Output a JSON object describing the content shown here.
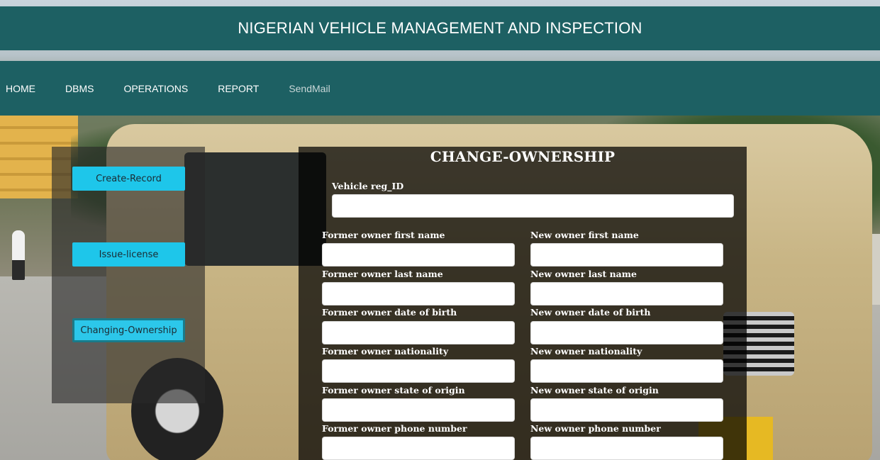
{
  "header": {
    "title": "NIGERIAN VEHICLE MANAGEMENT AND INSPECTION"
  },
  "nav": {
    "items": [
      "HOME",
      "DBMS",
      "OPERATIONS",
      "REPORT",
      "SendMail"
    ]
  },
  "sidebar": {
    "buttons": [
      "Create-Record",
      "Issue-license",
      "Changing-Ownership"
    ],
    "active": "Changing-Ownership"
  },
  "form": {
    "title": "CHANGE-OWNERSHIP",
    "vehicle_label": "Vehicle reg_ID",
    "vehicle_value": "",
    "former": {
      "first_name": "Former owner first name",
      "last_name": "Former owner last name",
      "dob": "Former owner date of birth",
      "nationality": "Former owner nationality",
      "state": "Former owner state of origin",
      "phone": "Former owner phone number"
    },
    "new": {
      "first_name": "New owner first name",
      "last_name": "New owner last name",
      "dob": "New owner date of birth",
      "nationality": "New owner nationality",
      "state": "New owner state of origin",
      "phone": "New owner phone number"
    }
  }
}
